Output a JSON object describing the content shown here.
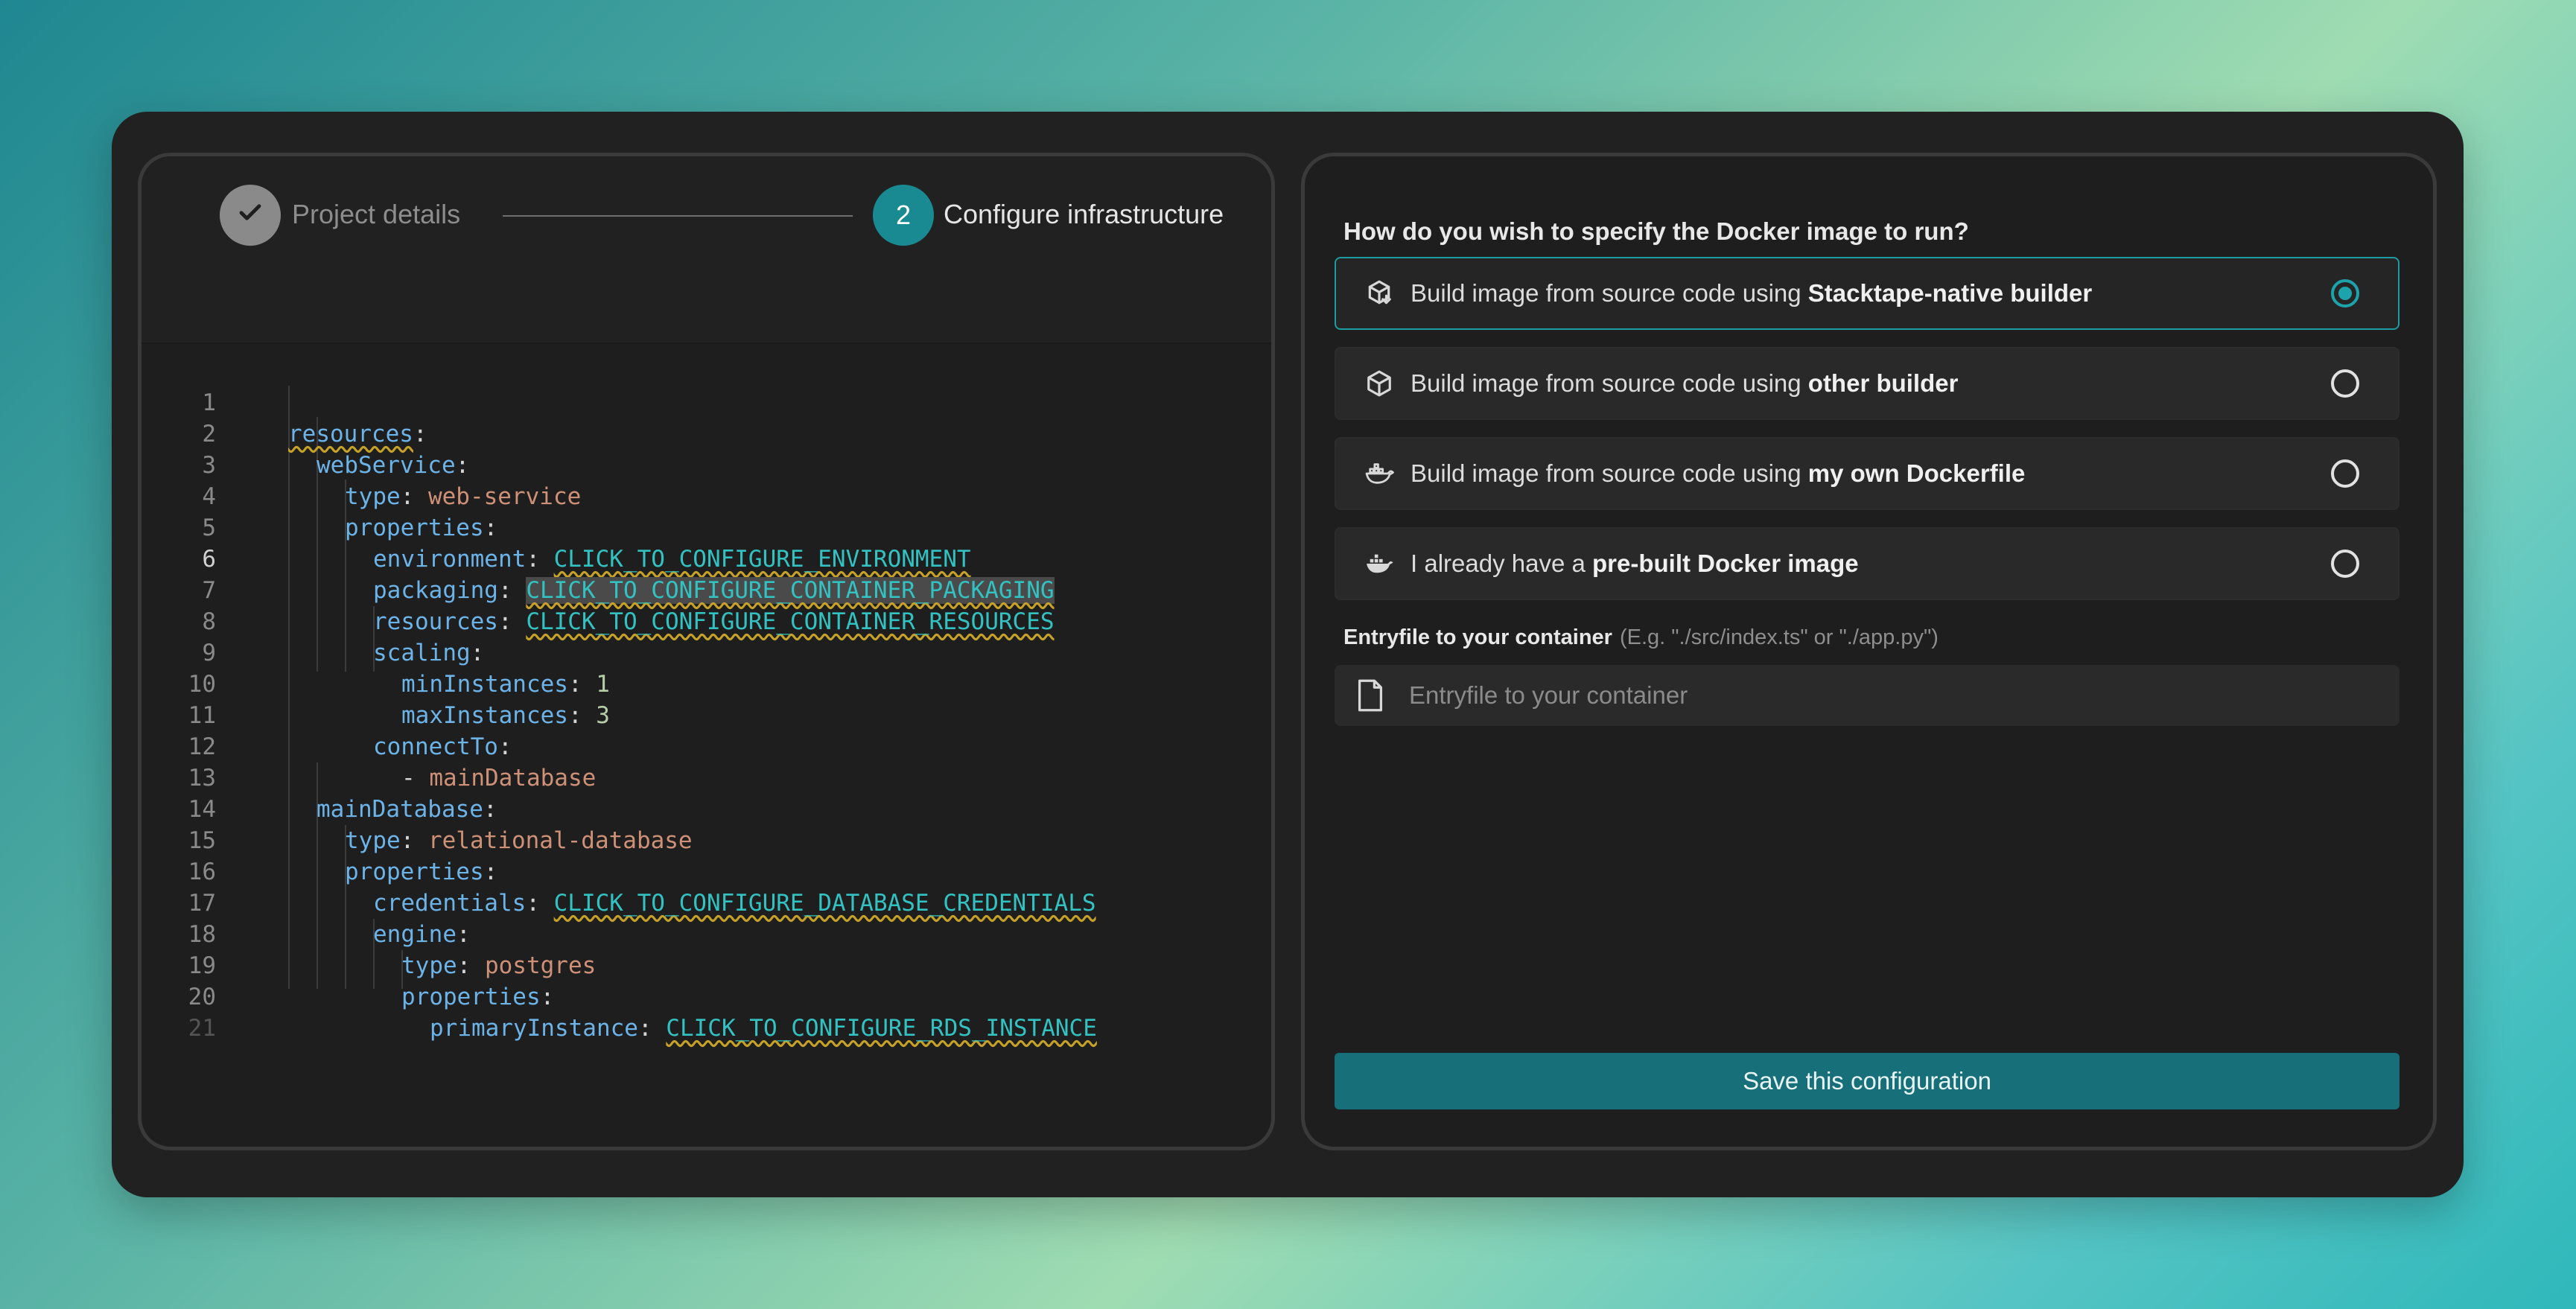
{
  "stepper": {
    "step1": {
      "label": "Project details",
      "status": "done",
      "icon": "check-icon"
    },
    "step2": {
      "number": "2",
      "label": "Configure infrastructure",
      "status": "active"
    }
  },
  "editor": {
    "line_numbers": [
      "1",
      "2",
      "3",
      "4",
      "5",
      "6",
      "7",
      "8",
      "9",
      "10",
      "11",
      "12",
      "13",
      "14",
      "15",
      "16",
      "17",
      "18",
      "19",
      "20",
      "21"
    ],
    "current_line": "6",
    "lines": {
      "l1": {
        "key": "resources",
        "colon": ":"
      },
      "l2": {
        "key": "webService",
        "colon": ":"
      },
      "l3": {
        "key": "type",
        "colon": ": ",
        "value": "web-service"
      },
      "l4": {
        "key": "properties",
        "colon": ":"
      },
      "l5": {
        "key": "environment",
        "colon": ": ",
        "value": "CLICK_TO_CONFIGURE_ENVIRONMENT"
      },
      "l6": {
        "key": "packaging",
        "colon": ": ",
        "value": "CLICK_TO_CONFIGURE_CONTAINER_PACKAGING"
      },
      "l7": {
        "key": "resources",
        "colon": ": ",
        "value": "CLICK_TO_CONFIGURE_CONTAINER_RESOURCES"
      },
      "l8": {
        "key": "scaling",
        "colon": ":"
      },
      "l9": {
        "key": "minInstances",
        "colon": ": ",
        "value": "1"
      },
      "l10": {
        "key": "maxInstances",
        "colon": ": ",
        "value": "3"
      },
      "l11": {
        "key": "connectTo",
        "colon": ":"
      },
      "l12": {
        "dash": "- ",
        "value": "mainDatabase"
      },
      "l13": {
        "key": "mainDatabase",
        "colon": ":"
      },
      "l14": {
        "key": "type",
        "colon": ": ",
        "value": "relational-database"
      },
      "l15": {
        "key": "properties",
        "colon": ":"
      },
      "l16": {
        "key": "credentials",
        "colon": ": ",
        "value": "CLICK_TO_CONFIGURE_DATABASE_CREDENTIALS"
      },
      "l17": {
        "key": "engine",
        "colon": ":"
      },
      "l18": {
        "key": "type",
        "colon": ": ",
        "value": "postgres"
      },
      "l19": {
        "key": "properties",
        "colon": ":"
      },
      "l20": {
        "key": "primaryInstance",
        "colon": ": ",
        "value": "CLICK_TO_CONFIGURE_RDS_INSTANCE"
      }
    }
  },
  "config": {
    "question": "How do you wish to specify the Docker image to run?",
    "options": [
      {
        "prefix": "Build image from source code using ",
        "bold": "Stacktape-native builder",
        "icon": "package-arrow-icon",
        "selected": true
      },
      {
        "prefix": "Build image from source code using ",
        "bold": "other builder",
        "icon": "package-icon",
        "selected": false
      },
      {
        "prefix": "Build image from source code using ",
        "bold": "my own Dockerfile",
        "icon": "docker-whale-icon",
        "selected": false
      },
      {
        "prefix": "I already have a ",
        "bold": "pre-built Docker image",
        "icon": "docker-whale-icon",
        "selected": false
      }
    ],
    "entryfile": {
      "label": "Entryfile to your container",
      "hint": "(E.g. \"./src/index.ts\" or \"./app.py\")",
      "placeholder": "Entryfile to your container",
      "value": "",
      "icon": "file-icon"
    },
    "save_label": "Save this configuration"
  },
  "colors": {
    "accent": "#1a8a92",
    "button": "#176f79",
    "panel": "#1e1e1e",
    "placeholder_token": "#33c2c2"
  }
}
